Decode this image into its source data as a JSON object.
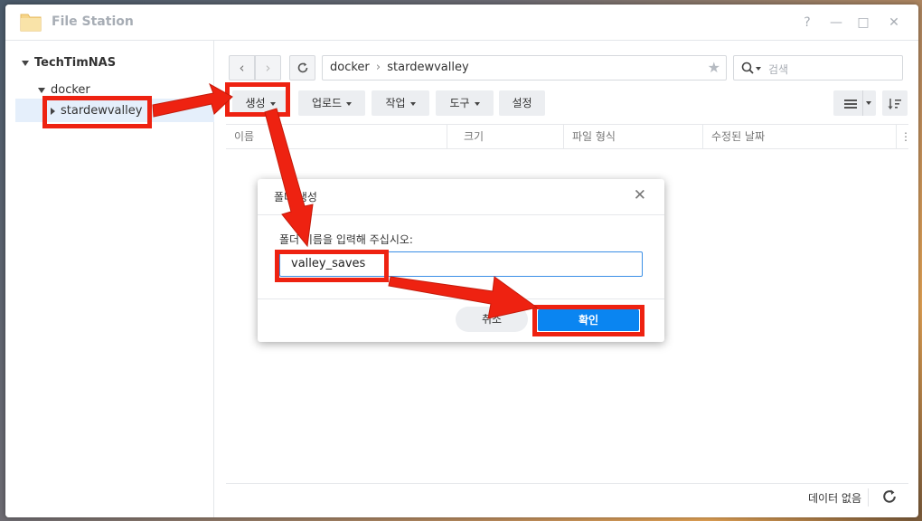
{
  "window": {
    "title": "File Station",
    "controls": [
      "?",
      "—",
      "□",
      "✕"
    ]
  },
  "sidebar": {
    "root": "TechTimNAS",
    "items": [
      {
        "label": "docker"
      },
      {
        "label": "stardewvalley"
      }
    ]
  },
  "nav": {
    "back": "‹",
    "forward": "›",
    "path": [
      "docker",
      "stardewvalley"
    ],
    "path_sep": "›",
    "star": "★",
    "search_placeholder": "검색"
  },
  "toolbar": {
    "create": "생성",
    "upload": "업로드",
    "action": "작업",
    "tools": "도구",
    "settings": "설정"
  },
  "table": {
    "columns": [
      "이름",
      "크기",
      "파일 형식",
      "수정된 날짜"
    ],
    "more": "⋮"
  },
  "footer": {
    "status": "데이터 없음"
  },
  "dialog": {
    "title": "폴더 생성",
    "close": "✕",
    "label": "폴더 이름을 입력해 주십시오:",
    "input_value": "valley_saves",
    "cancel": "취소",
    "ok": "확인"
  },
  "colors": {
    "accent": "#0a85f1",
    "highlight": "#ee2211",
    "selected_bg": "#e5effb"
  }
}
